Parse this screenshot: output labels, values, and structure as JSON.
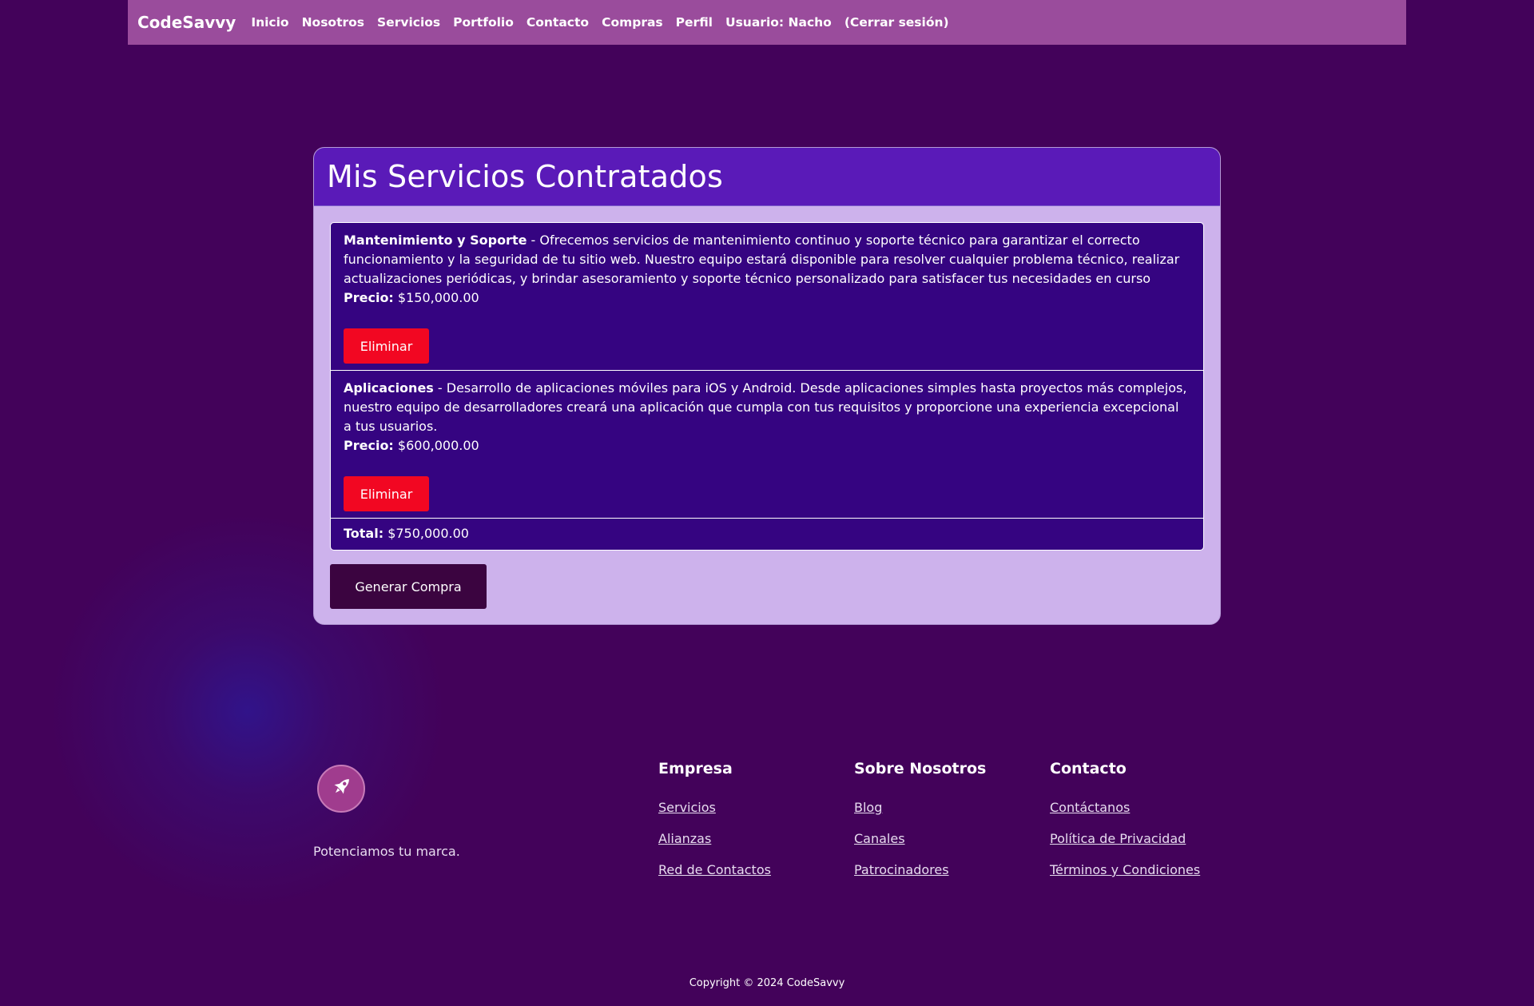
{
  "nav": {
    "brand": "CodeSavvy",
    "links": [
      "Inicio",
      "Nosotros",
      "Servicios",
      "Portfolio",
      "Contacto",
      "Compras",
      "Perfil",
      "Usuario: Nacho",
      "(Cerrar sesión)"
    ]
  },
  "main": {
    "title": "Mis Servicios Contratados",
    "items": [
      {
        "name": "Mantenimiento y Soporte",
        "description": " - Ofrecemos servicios de mantenimiento continuo y soporte técnico para garantizar el correcto funcionamiento y la seguridad de tu sitio web. Nuestro equipo estará disponible para resolver cualquier problema técnico, realizar actualizaciones periódicas, y brindar asesoramiento y soporte técnico personalizado para satisfacer tus necesidades en curso",
        "price_label": "Precio:",
        "price": " $150,000.00",
        "delete_label": "Eliminar"
      },
      {
        "name": "Aplicaciones",
        "description": " - Desarrollo de aplicaciones móviles para iOS y Android. Desde aplicaciones simples hasta proyectos más complejos, nuestro equipo de desarrolladores creará una aplicación que cumpla con tus requisitos y proporcione una experiencia excepcional a tus usuarios.",
        "price_label": "Precio:",
        "price": " $600,000.00",
        "delete_label": "Eliminar"
      }
    ],
    "total_label": "Total:",
    "total": " $750,000.00",
    "generate_label": "Generar Compra"
  },
  "footer": {
    "logo_icon": "rocket-icon",
    "tagline": "Potenciamos tu marca.",
    "columns": [
      {
        "title": "Empresa",
        "links": [
          "Servicios",
          "Alianzas",
          "Red de Contactos"
        ]
      },
      {
        "title": "Sobre Nosotros",
        "links": [
          "Blog",
          "Canales",
          "Patrocinadores"
        ]
      },
      {
        "title": "Contacto",
        "links": [
          "Contáctanos",
          "Política de Privacidad",
          "Términos y Condiciones"
        ]
      }
    ],
    "copyright": "Copyright © 2024 CodeSavvy"
  },
  "colors": {
    "background": "#43025a",
    "navbar": "#9a4c9c",
    "card_header": "#5a1ab8",
    "card_body": "#cdb2ec",
    "list_item": "#350481",
    "delete_button": "#f20722",
    "generate_button": "#3b0440"
  }
}
